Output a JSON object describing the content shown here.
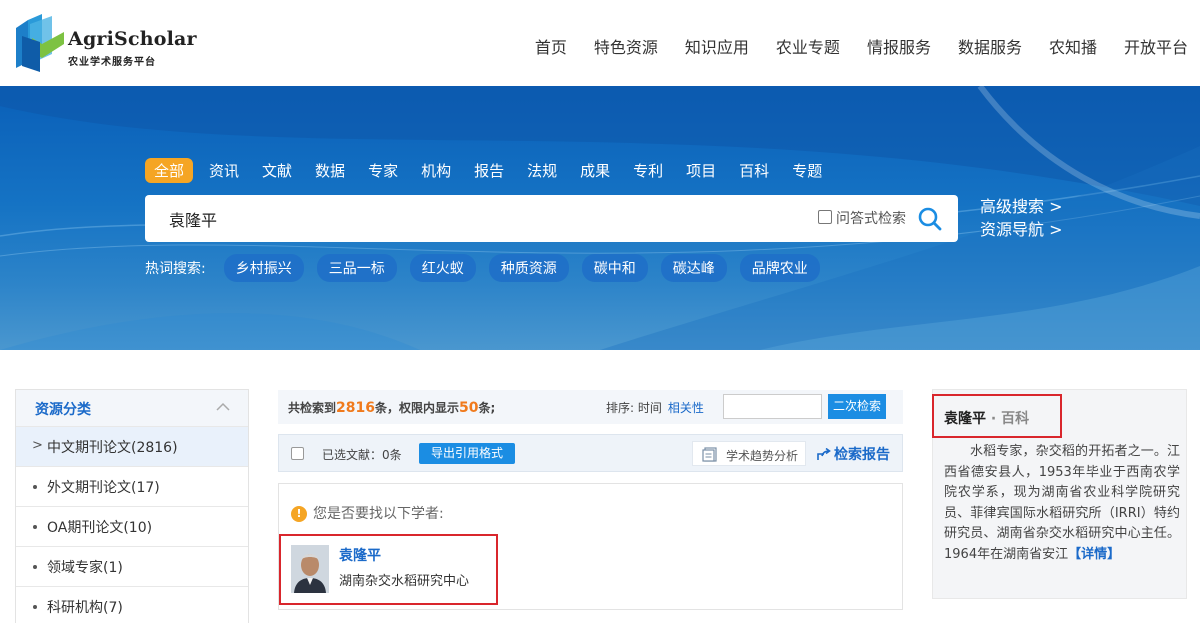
{
  "header": {
    "logo_title": "AgriScholar",
    "logo_subtitle": "农业学术服务平台",
    "nav": [
      "首页",
      "特色资源",
      "知识应用",
      "农业专题",
      "情报服务",
      "数据服务",
      "农知播",
      "开放平台"
    ]
  },
  "search": {
    "categories": [
      "全部",
      "资讯",
      "文献",
      "数据",
      "专家",
      "机构",
      "报告",
      "法规",
      "成果",
      "专利",
      "项目",
      "百科",
      "专题"
    ],
    "active_category": "全部",
    "query": "袁隆平",
    "qa_label": "问答式检索",
    "advanced_search": "高级搜索 >",
    "resource_nav": "资源导航 >",
    "hot_label": "热词搜索:",
    "hot_terms": [
      "乡村振兴",
      "三品一标",
      "红火蚁",
      "种质资源",
      "碳中和",
      "碳达峰",
      "品牌农业"
    ]
  },
  "sidebar": {
    "title": "资源分类",
    "items": [
      {
        "label": "中文期刊论文(2816)",
        "active": true
      },
      {
        "label": "外文期刊论文(17)",
        "active": false
      },
      {
        "label": "OA期刊论文(10)",
        "active": false
      },
      {
        "label": "领域专家(1)",
        "active": false
      },
      {
        "label": "科研机构(7)",
        "active": false
      }
    ]
  },
  "results": {
    "count_prefix": "共检索到",
    "total": "2816",
    "count_mid": "条，权限内显示",
    "shown": "50",
    "count_suffix": "条;",
    "sort_label": "排序:",
    "sort_time": "时间",
    "sort_relevance": "相关性",
    "secondary_search": "二次检索",
    "selected_label": "已选文献：0条",
    "export_button": "导出引用格式",
    "trend_button": "学术趋势分析",
    "report_link": "检索报告",
    "tip": "您是否要找以下学者:",
    "scholar": {
      "name": "袁隆平",
      "org": "湖南杂交水稻研究中心"
    }
  },
  "baike": {
    "name": "袁隆平",
    "type": "· 百科",
    "text": "水稻专家，杂交稻的开拓者之一。江西省德安县人，1953年毕业于西南农学院农学系，现为湖南省农业科学院研究员、菲律宾国际水稻研究所（IRRI）特约研究员、湖南省杂交水稻研究中心主任。 1964年在湖南省安江",
    "more": "【详情】"
  },
  "colors": {
    "brand_blue": "#1b6ac9",
    "accent_orange": "#f5a524",
    "highlight_red": "#d9262c"
  }
}
